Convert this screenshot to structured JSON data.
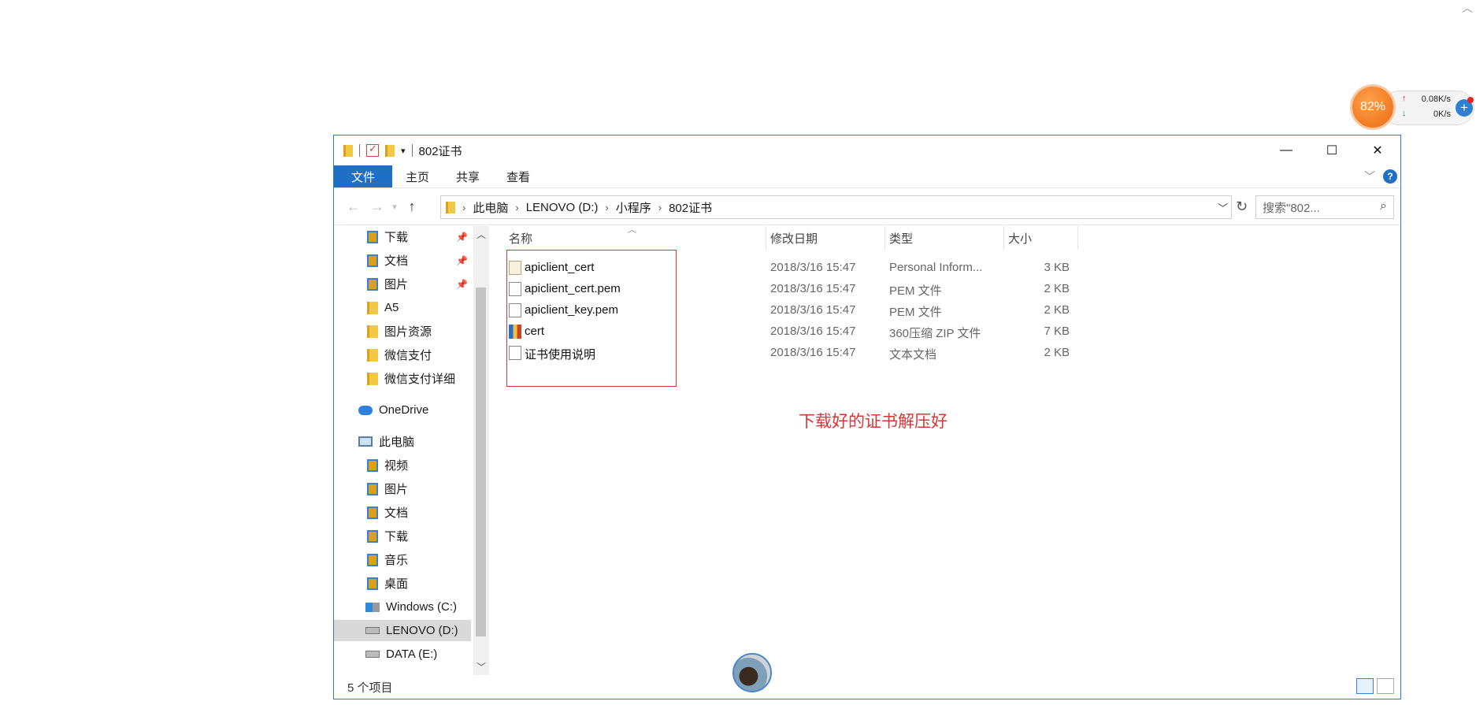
{
  "window": {
    "title": "802证书",
    "controls": {
      "minimize": "—",
      "maximize": "☐",
      "close": "✕"
    }
  },
  "ribbon": {
    "tabs": [
      "文件",
      "主页",
      "共享",
      "查看"
    ],
    "help": "?"
  },
  "address": {
    "crumbs": [
      "此电脑",
      "LENOVO (D:)",
      "小程序",
      "802证书"
    ],
    "search_placeholder": "搜索\"802..."
  },
  "sidebar": {
    "items": [
      {
        "label": "下载",
        "icon": "downloads-folder-icon",
        "pinned": true
      },
      {
        "label": "文档",
        "icon": "documents-folder-icon",
        "pinned": true
      },
      {
        "label": "图片",
        "icon": "pictures-folder-icon",
        "pinned": true
      },
      {
        "label": "A5",
        "icon": "folder-icon"
      },
      {
        "label": "图片资源",
        "icon": "folder-icon"
      },
      {
        "label": "微信支付",
        "icon": "folder-icon"
      },
      {
        "label": "微信支付详细",
        "icon": "folder-icon"
      },
      {
        "label": "OneDrive",
        "icon": "onedrive-cloud-icon"
      },
      {
        "label": "此电脑",
        "icon": "this-pc-icon"
      },
      {
        "label": "视频",
        "icon": "videos-folder-icon"
      },
      {
        "label": "图片",
        "icon": "pictures-folder-icon"
      },
      {
        "label": "文档",
        "icon": "documents-folder-icon"
      },
      {
        "label": "下载",
        "icon": "downloads-folder-icon"
      },
      {
        "label": "音乐",
        "icon": "music-folder-icon"
      },
      {
        "label": "桌面",
        "icon": "desktop-folder-icon"
      },
      {
        "label": "Windows (C:)",
        "icon": "windows-drive-icon"
      },
      {
        "label": "LENOVO (D:)",
        "icon": "drive-icon",
        "selected": true
      },
      {
        "label": "DATA (E:)",
        "icon": "drive-icon"
      }
    ]
  },
  "columns": {
    "name": "名称",
    "date": "修改日期",
    "type": "类型",
    "size": "大小"
  },
  "files": [
    {
      "name": "apiclient_cert",
      "date": "2018/3/16 15:47",
      "type": "Personal Inform...",
      "size": "3 KB",
      "icon": "certificate-file-icon"
    },
    {
      "name": "apiclient_cert.pem",
      "date": "2018/3/16 15:47",
      "type": "PEM 文件",
      "size": "2 KB",
      "icon": "pem-file-icon"
    },
    {
      "name": "apiclient_key.pem",
      "date": "2018/3/16 15:47",
      "type": "PEM 文件",
      "size": "2 KB",
      "icon": "pem-file-icon"
    },
    {
      "name": "cert",
      "date": "2018/3/16 15:47",
      "type": "360压缩 ZIP 文件",
      "size": "7 KB",
      "icon": "zip-archive-icon"
    },
    {
      "name": "证书使用说明",
      "date": "2018/3/16 15:47",
      "type": "文本文档",
      "size": "2 KB",
      "icon": "text-document-icon"
    }
  ],
  "annotation": "下载好的证书解压好",
  "status": {
    "count": "5 个项目"
  },
  "net_widget": {
    "percent": "82%",
    "upload": "0.08K/s",
    "download": "0K/s",
    "plus": "+"
  }
}
